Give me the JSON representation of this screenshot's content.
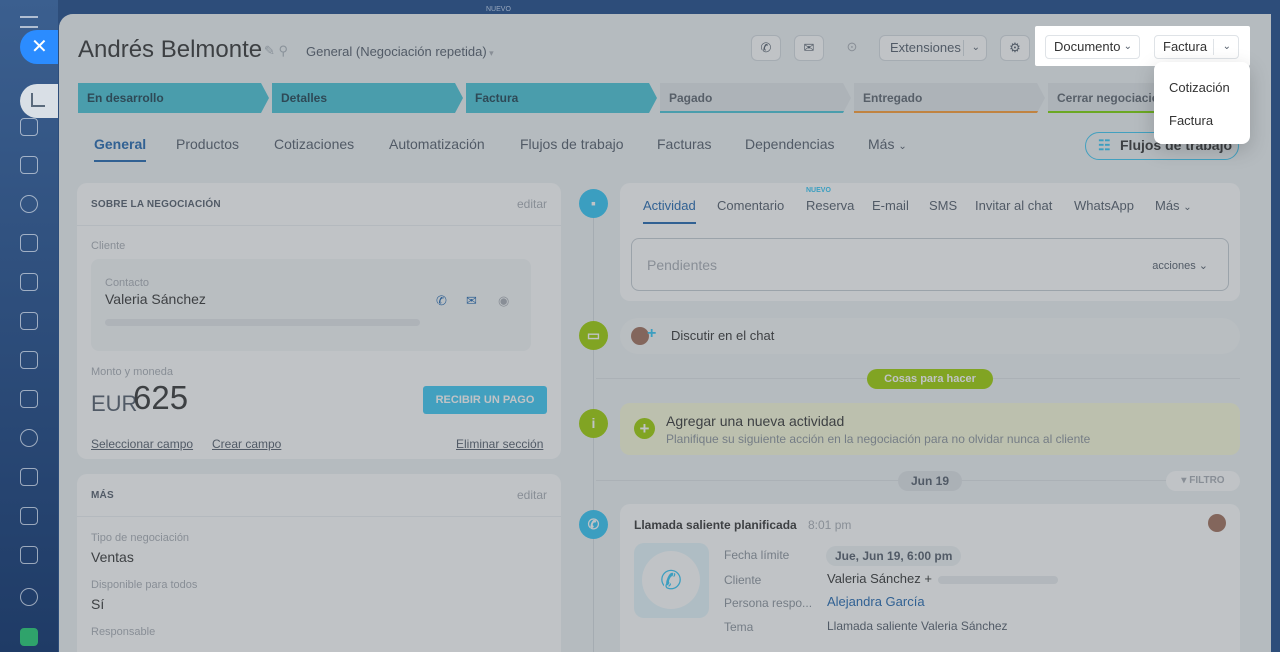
{
  "header": {
    "title": "Andrés Belmonte",
    "category": "General (Negociación repetida)",
    "extensions_label": "Extensiones",
    "top_banner": "NUEVO"
  },
  "highlight": {
    "document_label": "Documento",
    "invoice_label": "Factura",
    "menu_items": [
      "Cotización",
      "Factura"
    ]
  },
  "stages": [
    {
      "label": "En desarrollo"
    },
    {
      "label": "Detalles"
    },
    {
      "label": "Factura"
    },
    {
      "label": "Pagado"
    },
    {
      "label": "Entregado"
    },
    {
      "label": "Cerrar negociación"
    }
  ],
  "tabs": [
    "General",
    "Productos",
    "Cotizaciones",
    "Automatización",
    "Flujos de trabajo",
    "Facturas",
    "Dependencias",
    "Más"
  ],
  "workflows_button": "Flujos de trabajo",
  "about": {
    "title": "SOBRE LA NEGOCIACIÓN",
    "edit": "editar",
    "client_label": "Cliente",
    "contact_label": "Contacto",
    "contact_name": "Valeria Sánchez",
    "amount_label": "Monto y moneda",
    "currency": "EUR",
    "amount": "625",
    "pay_button": "RECIBIR UN PAGO",
    "select_field": "Seleccionar campo",
    "create_field": "Crear campo",
    "delete_section": "Eliminar sección"
  },
  "more": {
    "title": "MÁS",
    "edit": "editar",
    "deal_type_label": "Tipo de negociación",
    "deal_type": "Ventas",
    "available_label": "Disponible para todos",
    "available": "Sí",
    "responsible_label": "Responsable"
  },
  "timeline": {
    "tabs": [
      "Actividad",
      "Comentario",
      "Reserva",
      "E-mail",
      "SMS",
      "Invitar al chat",
      "WhatsApp",
      "Más"
    ],
    "new_badge": "NUEVO",
    "pending_placeholder": "Pendientes",
    "actions": "acciones",
    "discuss_chat": "Discutir en el chat",
    "todo_label": "Cosas para hacer",
    "add_activity_title": "Agregar una nueva actividad",
    "add_activity_sub": "Planifique su siguiente acción en la negociación para no olvidar nunca al cliente",
    "date_label": "Jun 19",
    "filter_label": "FILTRO",
    "call_title": "Llamada saliente planificada",
    "call_time": "8:01 pm",
    "deadline_label": "Fecha límite",
    "deadline_value": "Jue, Jun 19, 6:00 pm",
    "client_label": "Cliente",
    "client_value": "Valeria Sánchez +",
    "responsible_label": "Persona respo...",
    "responsible_value": "Alejandra García",
    "subject_label": "Tema",
    "subject_value": "Llamada saliente Valeria Sánchez"
  },
  "colors": {
    "stage_active": "#47c4d6",
    "accent_blue": "#2067b0",
    "todo_green": "#9dcf00",
    "pay_button": "#3bc8f5"
  }
}
